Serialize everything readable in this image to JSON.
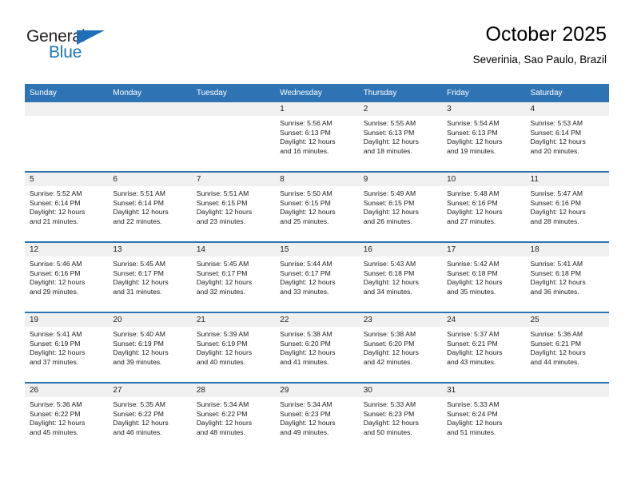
{
  "brand": {
    "name_part1": "General",
    "name_part2": "Blue",
    "logo_icon": "triangle-logo-icon",
    "accent_color": "#1b75bb"
  },
  "header": {
    "title": "October 2025",
    "subtitle": "Severinia, Sao Paulo, Brazil"
  },
  "theme": {
    "header_blue": "#2e74b5",
    "daynum_gray": "#f0f0f0"
  },
  "calendar": {
    "weekday_headers": [
      "Sunday",
      "Monday",
      "Tuesday",
      "Wednesday",
      "Thursday",
      "Friday",
      "Saturday"
    ],
    "weeks": [
      [
        {
          "day": "",
          "sunrise": "",
          "sunset": "",
          "daylight_line1": "",
          "daylight_line2": ""
        },
        {
          "day": "",
          "sunrise": "",
          "sunset": "",
          "daylight_line1": "",
          "daylight_line2": ""
        },
        {
          "day": "",
          "sunrise": "",
          "sunset": "",
          "daylight_line1": "",
          "daylight_line2": ""
        },
        {
          "day": "1",
          "sunrise": "Sunrise: 5:56 AM",
          "sunset": "Sunset: 6:13 PM",
          "daylight_line1": "Daylight: 12 hours",
          "daylight_line2": "and 16 minutes."
        },
        {
          "day": "2",
          "sunrise": "Sunrise: 5:55 AM",
          "sunset": "Sunset: 6:13 PM",
          "daylight_line1": "Daylight: 12 hours",
          "daylight_line2": "and 18 minutes."
        },
        {
          "day": "3",
          "sunrise": "Sunrise: 5:54 AM",
          "sunset": "Sunset: 6:13 PM",
          "daylight_line1": "Daylight: 12 hours",
          "daylight_line2": "and 19 minutes."
        },
        {
          "day": "4",
          "sunrise": "Sunrise: 5:53 AM",
          "sunset": "Sunset: 6:14 PM",
          "daylight_line1": "Daylight: 12 hours",
          "daylight_line2": "and 20 minutes."
        }
      ],
      [
        {
          "day": "5",
          "sunrise": "Sunrise: 5:52 AM",
          "sunset": "Sunset: 6:14 PM",
          "daylight_line1": "Daylight: 12 hours",
          "daylight_line2": "and 21 minutes."
        },
        {
          "day": "6",
          "sunrise": "Sunrise: 5:51 AM",
          "sunset": "Sunset: 6:14 PM",
          "daylight_line1": "Daylight: 12 hours",
          "daylight_line2": "and 22 minutes."
        },
        {
          "day": "7",
          "sunrise": "Sunrise: 5:51 AM",
          "sunset": "Sunset: 6:15 PM",
          "daylight_line1": "Daylight: 12 hours",
          "daylight_line2": "and 23 minutes."
        },
        {
          "day": "8",
          "sunrise": "Sunrise: 5:50 AM",
          "sunset": "Sunset: 6:15 PM",
          "daylight_line1": "Daylight: 12 hours",
          "daylight_line2": "and 25 minutes."
        },
        {
          "day": "9",
          "sunrise": "Sunrise: 5:49 AM",
          "sunset": "Sunset: 6:15 PM",
          "daylight_line1": "Daylight: 12 hours",
          "daylight_line2": "and 26 minutes."
        },
        {
          "day": "10",
          "sunrise": "Sunrise: 5:48 AM",
          "sunset": "Sunset: 6:16 PM",
          "daylight_line1": "Daylight: 12 hours",
          "daylight_line2": "and 27 minutes."
        },
        {
          "day": "11",
          "sunrise": "Sunrise: 5:47 AM",
          "sunset": "Sunset: 6:16 PM",
          "daylight_line1": "Daylight: 12 hours",
          "daylight_line2": "and 28 minutes."
        }
      ],
      [
        {
          "day": "12",
          "sunrise": "Sunrise: 5:46 AM",
          "sunset": "Sunset: 6:16 PM",
          "daylight_line1": "Daylight: 12 hours",
          "daylight_line2": "and 29 minutes."
        },
        {
          "day": "13",
          "sunrise": "Sunrise: 5:45 AM",
          "sunset": "Sunset: 6:17 PM",
          "daylight_line1": "Daylight: 12 hours",
          "daylight_line2": "and 31 minutes."
        },
        {
          "day": "14",
          "sunrise": "Sunrise: 5:45 AM",
          "sunset": "Sunset: 6:17 PM",
          "daylight_line1": "Daylight: 12 hours",
          "daylight_line2": "and 32 minutes."
        },
        {
          "day": "15",
          "sunrise": "Sunrise: 5:44 AM",
          "sunset": "Sunset: 6:17 PM",
          "daylight_line1": "Daylight: 12 hours",
          "daylight_line2": "and 33 minutes."
        },
        {
          "day": "16",
          "sunrise": "Sunrise: 5:43 AM",
          "sunset": "Sunset: 6:18 PM",
          "daylight_line1": "Daylight: 12 hours",
          "daylight_line2": "and 34 minutes."
        },
        {
          "day": "17",
          "sunrise": "Sunrise: 5:42 AM",
          "sunset": "Sunset: 6:18 PM",
          "daylight_line1": "Daylight: 12 hours",
          "daylight_line2": "and 35 minutes."
        },
        {
          "day": "18",
          "sunrise": "Sunrise: 5:41 AM",
          "sunset": "Sunset: 6:18 PM",
          "daylight_line1": "Daylight: 12 hours",
          "daylight_line2": "and 36 minutes."
        }
      ],
      [
        {
          "day": "19",
          "sunrise": "Sunrise: 5:41 AM",
          "sunset": "Sunset: 6:19 PM",
          "daylight_line1": "Daylight: 12 hours",
          "daylight_line2": "and 37 minutes."
        },
        {
          "day": "20",
          "sunrise": "Sunrise: 5:40 AM",
          "sunset": "Sunset: 6:19 PM",
          "daylight_line1": "Daylight: 12 hours",
          "daylight_line2": "and 39 minutes."
        },
        {
          "day": "21",
          "sunrise": "Sunrise: 5:39 AM",
          "sunset": "Sunset: 6:19 PM",
          "daylight_line1": "Daylight: 12 hours",
          "daylight_line2": "and 40 minutes."
        },
        {
          "day": "22",
          "sunrise": "Sunrise: 5:38 AM",
          "sunset": "Sunset: 6:20 PM",
          "daylight_line1": "Daylight: 12 hours",
          "daylight_line2": "and 41 minutes."
        },
        {
          "day": "23",
          "sunrise": "Sunrise: 5:38 AM",
          "sunset": "Sunset: 6:20 PM",
          "daylight_line1": "Daylight: 12 hours",
          "daylight_line2": "and 42 minutes."
        },
        {
          "day": "24",
          "sunrise": "Sunrise: 5:37 AM",
          "sunset": "Sunset: 6:21 PM",
          "daylight_line1": "Daylight: 12 hours",
          "daylight_line2": "and 43 minutes."
        },
        {
          "day": "25",
          "sunrise": "Sunrise: 5:36 AM",
          "sunset": "Sunset: 6:21 PM",
          "daylight_line1": "Daylight: 12 hours",
          "daylight_line2": "and 44 minutes."
        }
      ],
      [
        {
          "day": "26",
          "sunrise": "Sunrise: 5:36 AM",
          "sunset": "Sunset: 6:22 PM",
          "daylight_line1": "Daylight: 12 hours",
          "daylight_line2": "and 45 minutes."
        },
        {
          "day": "27",
          "sunrise": "Sunrise: 5:35 AM",
          "sunset": "Sunset: 6:22 PM",
          "daylight_line1": "Daylight: 12 hours",
          "daylight_line2": "and 46 minutes."
        },
        {
          "day": "28",
          "sunrise": "Sunrise: 5:34 AM",
          "sunset": "Sunset: 6:22 PM",
          "daylight_line1": "Daylight: 12 hours",
          "daylight_line2": "and 48 minutes."
        },
        {
          "day": "29",
          "sunrise": "Sunrise: 5:34 AM",
          "sunset": "Sunset: 6:23 PM",
          "daylight_line1": "Daylight: 12 hours",
          "daylight_line2": "and 49 minutes."
        },
        {
          "day": "30",
          "sunrise": "Sunrise: 5:33 AM",
          "sunset": "Sunset: 6:23 PM",
          "daylight_line1": "Daylight: 12 hours",
          "daylight_line2": "and 50 minutes."
        },
        {
          "day": "31",
          "sunrise": "Sunrise: 5:33 AM",
          "sunset": "Sunset: 6:24 PM",
          "daylight_line1": "Daylight: 12 hours",
          "daylight_line2": "and 51 minutes."
        },
        {
          "day": "",
          "sunrise": "",
          "sunset": "",
          "daylight_line1": "",
          "daylight_line2": ""
        }
      ]
    ]
  }
}
